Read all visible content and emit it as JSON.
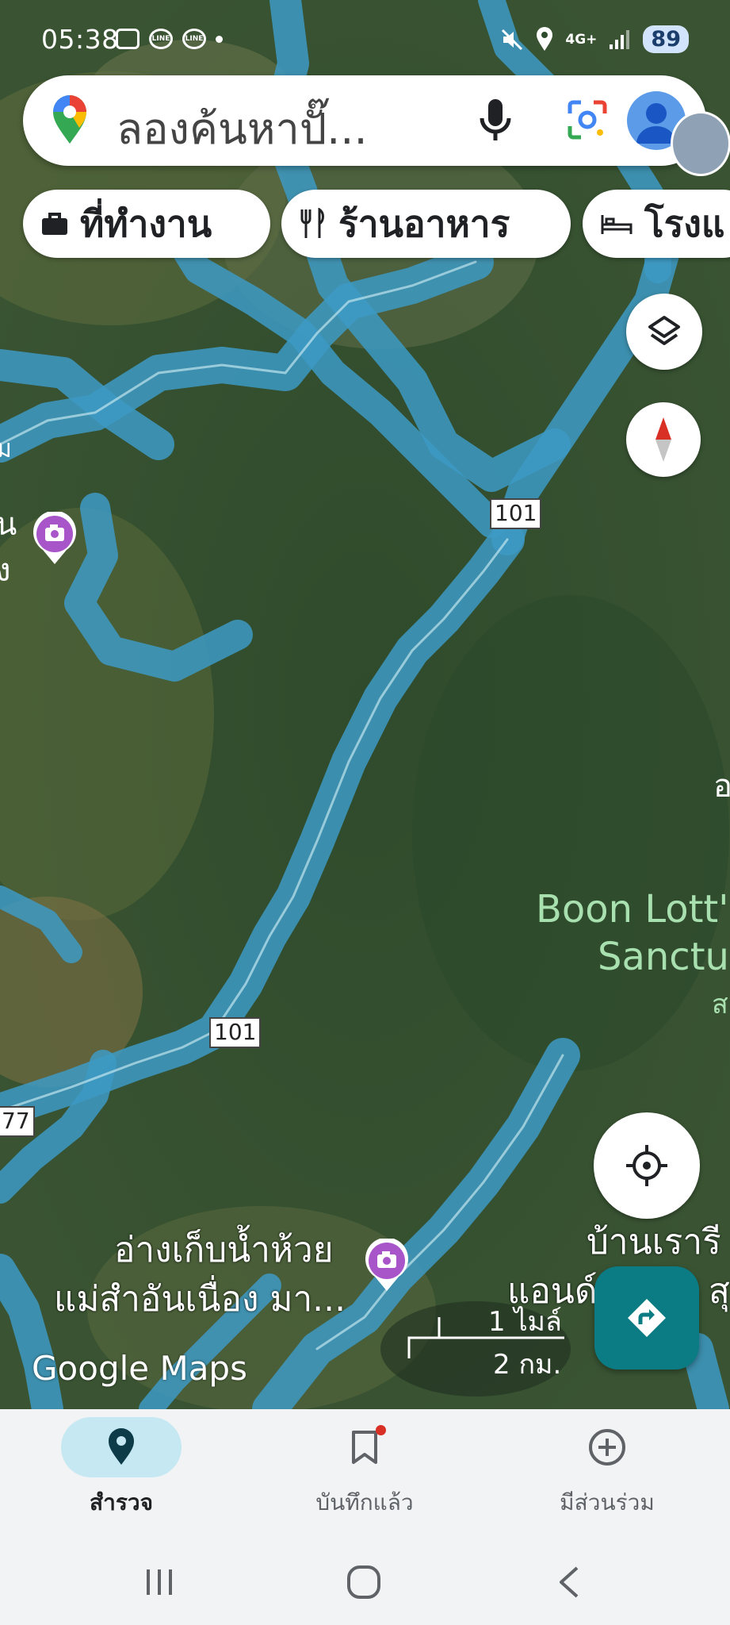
{
  "status_bar": {
    "time": "05:38",
    "battery": "89",
    "network": "4G+"
  },
  "search": {
    "placeholder": "ลองค้นหาปั๊...",
    "mic_icon": "mic-icon",
    "lens_icon": "lens-icon"
  },
  "chips": [
    {
      "label": "ที่ทำงาน",
      "icon": "briefcase-icon"
    },
    {
      "label": "ร้านอาหาร",
      "icon": "fork-knife-icon"
    },
    {
      "label": "โรงแ",
      "icon": "bed-icon"
    }
  ],
  "map": {
    "route_shields": [
      "101",
      "101",
      "77"
    ],
    "labels": {
      "sanctuary_line1": "Boon Lott's",
      "sanctuary_line2": "Sanctua",
      "sanctuary_line3": "ส",
      "reservoir_line1": "อ่างเก็บน้ำห้วย",
      "reservoir_line2": "แม่สำอันเนื่อง มา...",
      "village_line1": "บ้านเรารี",
      "village_line2": "แอนด์",
      "village_line2b": "ุ สุ",
      "left_edge_1": "ม",
      "left_edge_2": "น",
      "left_edge_3": "ง",
      "right_edge": "อ"
    },
    "scale": {
      "imperial": "1 ไมล์",
      "metric": "2 กม."
    },
    "attribution": "Google Maps"
  },
  "bottom_nav": [
    {
      "label": "สำรวจ",
      "icon": "location-pin-icon",
      "active": true
    },
    {
      "label": "บันทึกแล้ว",
      "icon": "bookmark-icon",
      "active": false
    },
    {
      "label": "มีส่วนร่วม",
      "icon": "add-circle-icon",
      "active": false
    }
  ],
  "colors": {
    "accent": "#0b7b84",
    "map_green": "#3c5a34",
    "road_overlay": "#3d9ac4",
    "label_green": "#a8e0b0"
  }
}
